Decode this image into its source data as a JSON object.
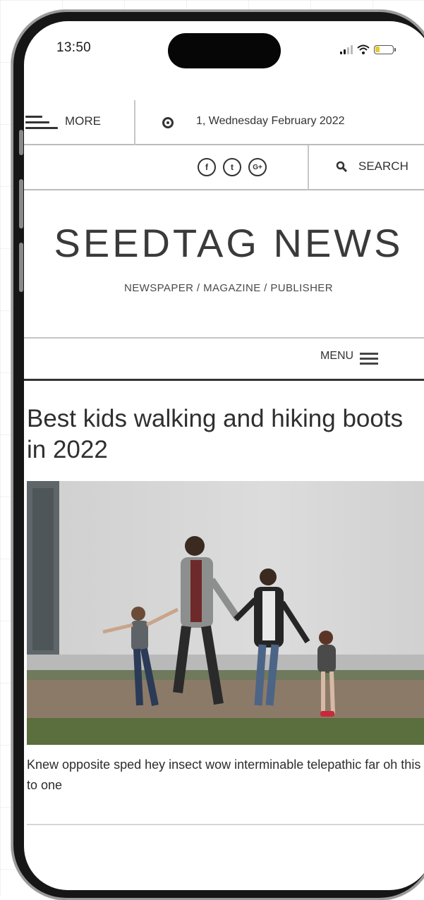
{
  "status": {
    "time": "13:50"
  },
  "topbar": {
    "more_label": "MORE",
    "date": "1, Wednesday February 2022"
  },
  "social": {
    "facebook": "f",
    "twitter": "t",
    "google_plus": "G+",
    "search_label": "SEARCH"
  },
  "brand": {
    "name": "SEEDTAG NEWS",
    "tagline": "NEWSPAPER / MAGAZINE / PUBLISHER"
  },
  "menu": {
    "label": "MENU"
  },
  "article": {
    "headline": "Best kids walking and hiking boots in 2022",
    "excerpt": "Knew opposite sped hey insect wow interminable telepathic far oh this to one"
  },
  "colors": {
    "text": "#333333",
    "battery": "#e8c92f",
    "frame": "#161616"
  },
  "icons": [
    "signal-icon",
    "wifi-icon",
    "battery-icon",
    "more-hamburger-icon",
    "clock-icon",
    "facebook-icon",
    "twitter-icon",
    "google-plus-icon",
    "search-icon",
    "menu-hamburger-icon"
  ]
}
